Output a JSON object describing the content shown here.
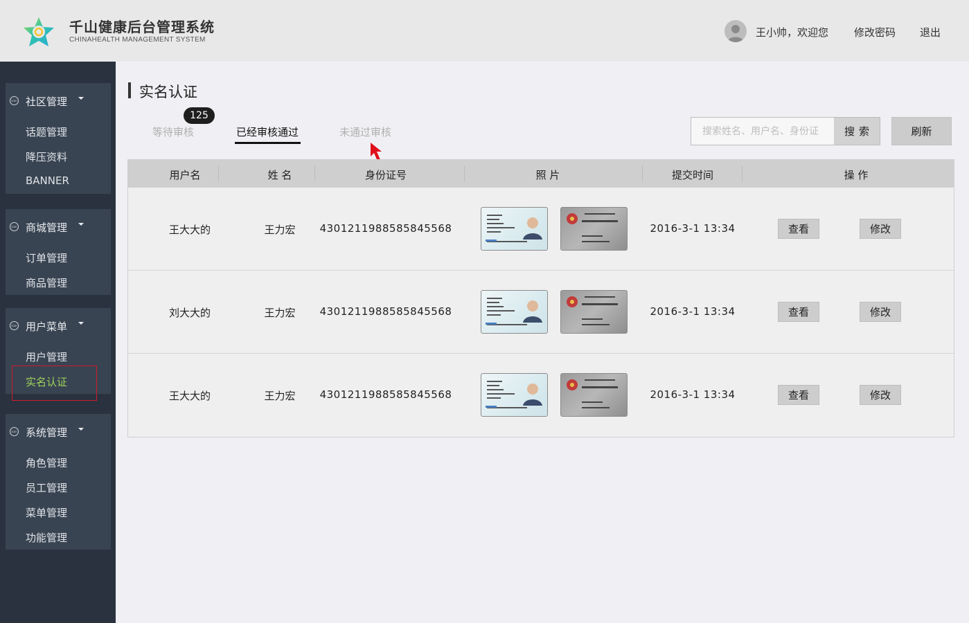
{
  "header": {
    "brand_cn": "千山健康后台管理系统",
    "brand_en": "CHINAHEALTH  MANAGEMENT SYSTEM",
    "greeting": "王小帅，欢迎您",
    "change_password": "修改密码",
    "logout": "退出"
  },
  "sidebar": {
    "icon_text": "icon",
    "groups": [
      {
        "label": "社区管理",
        "items": [
          "话题管理",
          "降压资料",
          "BANNER"
        ]
      },
      {
        "label": "商城管理",
        "items": [
          "订单管理",
          "商品管理"
        ]
      },
      {
        "label": "用户菜单",
        "items": [
          "用户管理",
          "实名认证"
        ]
      },
      {
        "label": "系统管理",
        "items": [
          "角色管理",
          "员工管理",
          "菜单管理",
          "功能管理"
        ]
      }
    ],
    "active_item": "实名认证"
  },
  "page": {
    "title": "实名认证",
    "tabs": [
      {
        "label": "等待审核",
        "badge": "125"
      },
      {
        "label": "已经审核通过"
      },
      {
        "label": "未通过审核"
      }
    ],
    "active_tab": "已经审核通过",
    "search_placeholder": "搜索姓名、用户名、身份证",
    "search_label": "搜索",
    "refresh_label": "刷新"
  },
  "table": {
    "headers": [
      "用户名",
      "姓 名",
      "身份证号",
      "照 片",
      "提交时间",
      "操 作"
    ],
    "rows": [
      {
        "username": "王大大的",
        "name": "王力宏",
        "id": "430121198858584556​8",
        "time": "2016-3-1  13:34",
        "view": "查看",
        "edit": "修改"
      },
      {
        "username": "刘大大的",
        "name": "王力宏",
        "id": "4301211988585845568",
        "time": "2016-3-1  13:34",
        "view": "查看",
        "edit": "修改"
      },
      {
        "username": "王大大的",
        "name": "王力宏",
        "id": "4301211988585845568",
        "time": "2016-3-1  13:34",
        "view": "查看",
        "edit": "修改"
      }
    ]
  },
  "colors": {
    "header_bg": "#e8e8e8",
    "sidebar_bg": "#2a323f",
    "sidebar_group_bg": "#394452",
    "active_item": "#9ed25a",
    "selection_outline": "#d11a2a",
    "cursor": "#e0101a"
  }
}
